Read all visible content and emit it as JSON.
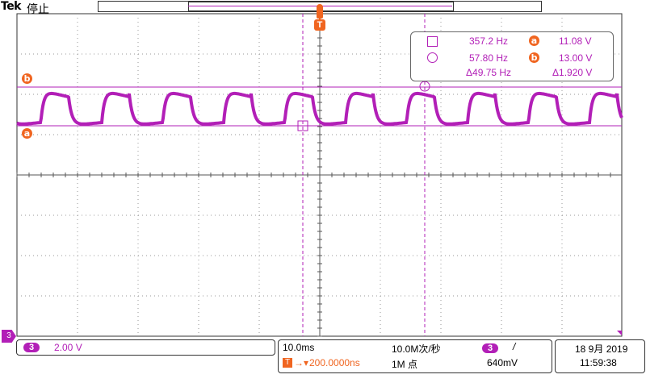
{
  "header": {
    "brand": "Tek",
    "state": "停止"
  },
  "markers": {
    "trigger_label": "T",
    "cursor_a": "a",
    "cursor_b": "b",
    "channel": "3"
  },
  "cursors": {
    "period1": "357.2 Hz",
    "freq2": "57.80 Hz",
    "delta_freq": "Δ49.75 Hz",
    "a_level": "11.08 V",
    "b_level": "13.00 V",
    "delta_level": "Δ1.920 V"
  },
  "bottom": {
    "channel_num": "3",
    "channel_scale": "2.00 V",
    "timebase": "10.0ms",
    "trigger_pos": "200.0000ns",
    "sample_rate": "10.0M次/秒",
    "record_length": "1M 点",
    "trig_channel": "3",
    "trig_slope": "/",
    "trig_level": "640mV",
    "date": "18 9月 2019",
    "time": "11:59:38"
  },
  "colors": {
    "trace": "#b21fb7",
    "cursor": "#f06520",
    "grid": "#9a9a9a"
  }
}
